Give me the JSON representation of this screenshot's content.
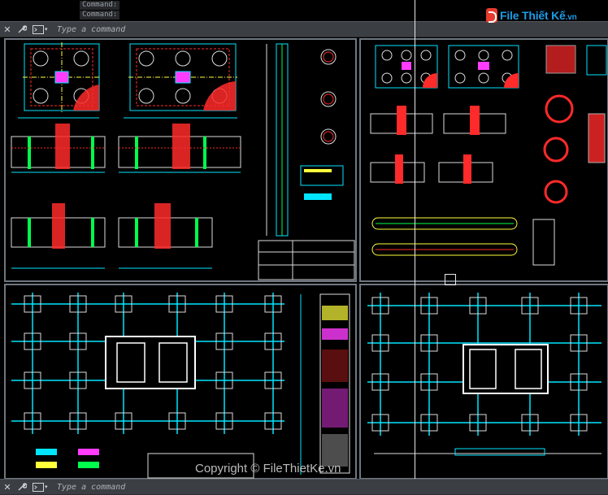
{
  "command_history": [
    "Command:",
    "Command:"
  ],
  "command_line": {
    "placeholder": "Type a command"
  },
  "logo": {
    "brand": "File Thiết Kế",
    "tld": ".vn"
  },
  "watermark": "Copyright © FileThietKe.vn",
  "colors": {
    "accent_cyan": "#00e5ff",
    "accent_red": "#ff2a2a",
    "accent_green": "#00ff4c",
    "accent_yellow": "#ffff3c",
    "accent_magenta": "#ff3cff",
    "panel_bg": "#3b3e43"
  },
  "icons": {
    "close": "close-icon",
    "customize": "wrench-icon",
    "prompt": "command-prompt-icon"
  }
}
